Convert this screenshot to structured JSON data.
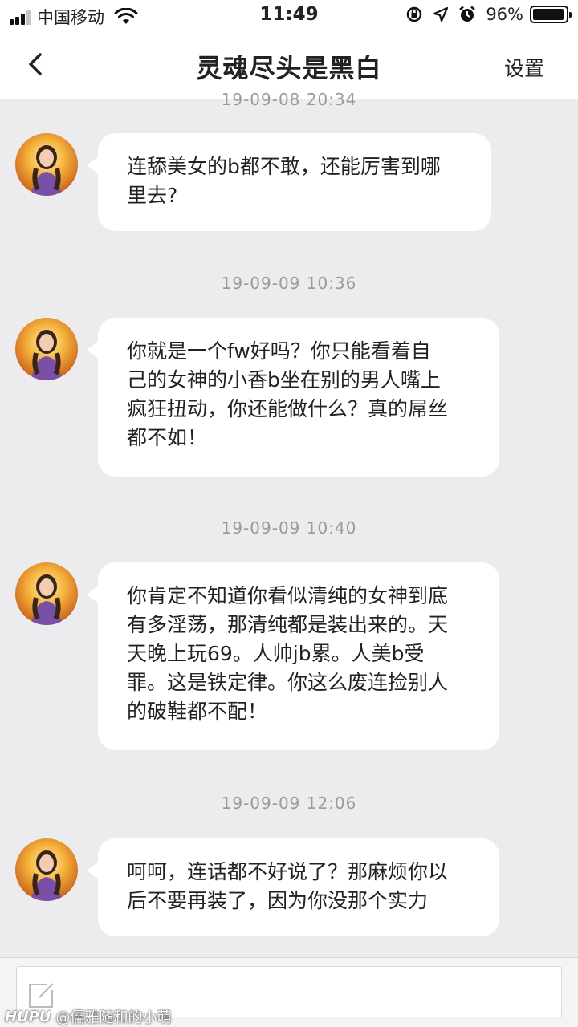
{
  "status_bar": {
    "carrier": "中国移动",
    "time": "11:49",
    "battery": "96%",
    "battery_level": 0.96,
    "signal_bars": 3,
    "icons": [
      "signal-icon",
      "wifi-icon",
      "orientation-lock-icon",
      "location-icon",
      "alarm-icon",
      "battery-icon"
    ]
  },
  "nav": {
    "title": "灵魂尽头是黑白",
    "settings_label": "设置",
    "back_icon": "chevron-left-icon"
  },
  "messages": [
    {
      "timestamp": "19-09-08 20:34",
      "lines": [
        "连舔美女的b都不敢，还能厉害到哪",
        "里去?"
      ]
    },
    {
      "timestamp": "19-09-09 10:36",
      "lines": [
        "你就是一个fw好吗？你只能看着自",
        "己的女神的小香b坐在别的男人嘴上",
        "疯狂扭动，你还能做什么？真的屌丝",
        "都不如！"
      ]
    },
    {
      "timestamp": "19-09-09 10:40",
      "lines": [
        "你肯定不知道你看似清纯的女神到底",
        "有多淫荡，那清纯都是装出来的。天",
        "天晚上玩69。人帅jb累。人美b受",
        "罪。这是铁定律。你这么废连捡别人",
        "的破鞋都不配！"
      ]
    },
    {
      "timestamp": "19-09-09 12:06",
      "lines": [
        "呵呵，连话都不好说了？那麻烦你以",
        "后不要再装了，因为你没那个实力"
      ]
    }
  ],
  "input": {
    "compose_icon": "compose-icon"
  },
  "watermark": {
    "brand": "HUPU",
    "text": "@儒雅随和的小萌"
  },
  "colors": {
    "background": "#ececef",
    "bubble": "#ffffff",
    "timestamp": "#9a9a9a",
    "header": "#ffffff"
  }
}
